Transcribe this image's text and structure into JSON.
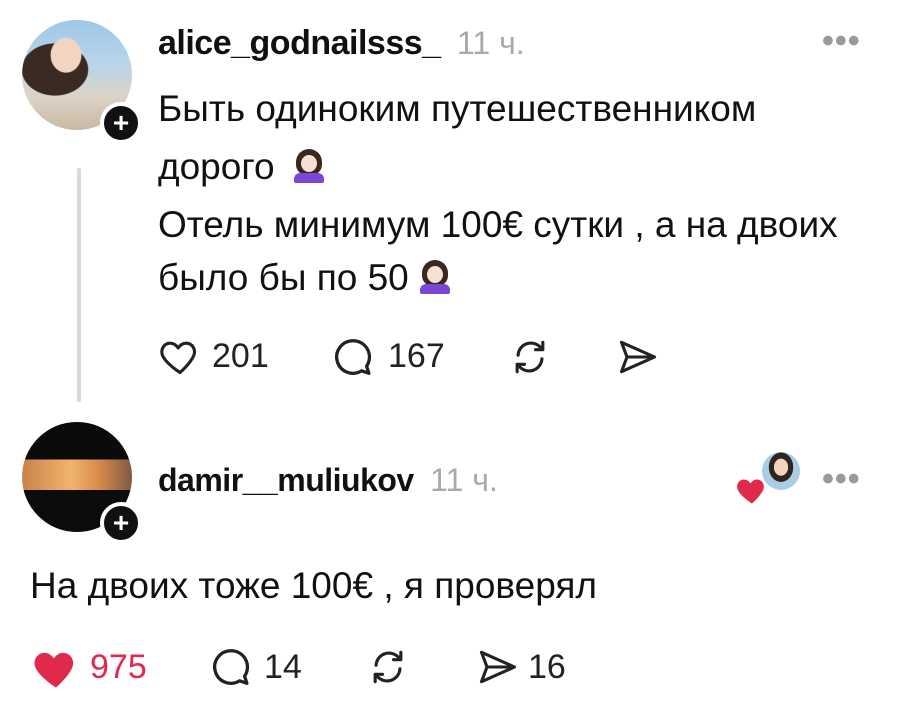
{
  "posts": [
    {
      "username": "alice_godnailsss_",
      "time": "11 ч.",
      "text_lines": [
        "Быть одиноким путешественником",
        "дорого",
        "Отель минимум 100€ сутки , а на двоих",
        "было бы по 50"
      ],
      "likes": "201",
      "comments": "167"
    },
    {
      "username": "damir__muliukov",
      "time": "11 ч.",
      "text": "На двоих тоже 100€ , я проверял",
      "likes": "975",
      "comments": "14",
      "shares": "16"
    }
  ],
  "colors": {
    "like_active": "#e0294d",
    "muted_text": "#a9a9a9",
    "emoji_shirt": "#7a46d6"
  },
  "icons": [
    "heart-icon",
    "comment-icon",
    "repost-icon",
    "share-icon",
    "plus-icon",
    "more-icon",
    "shrug-emoji"
  ]
}
